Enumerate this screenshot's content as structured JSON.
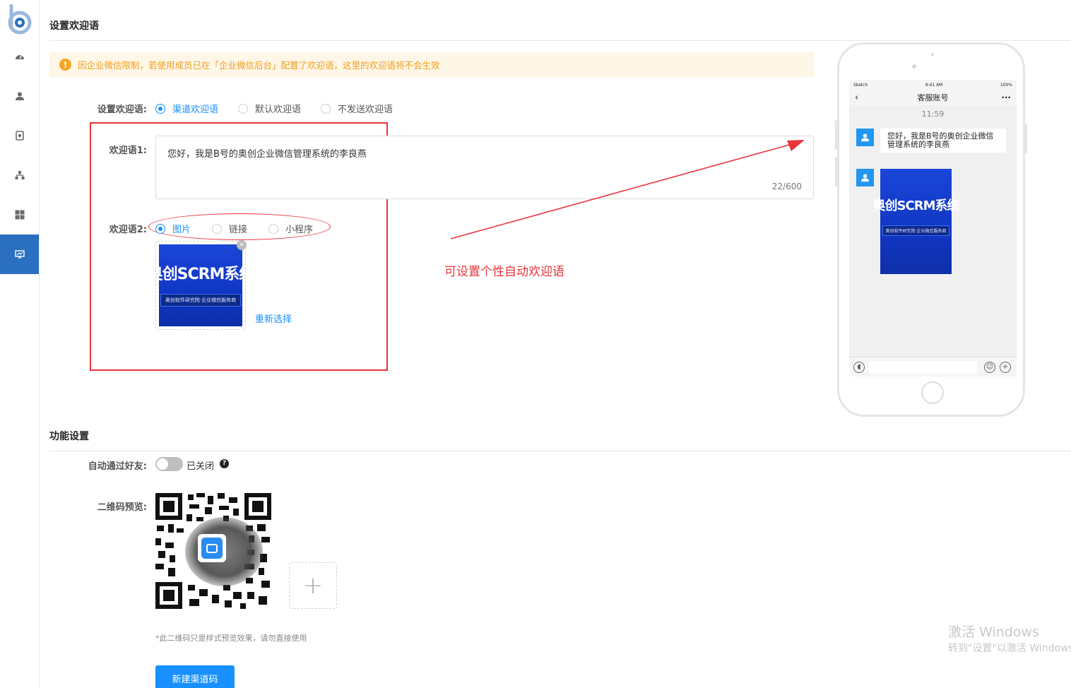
{
  "sidebar": {
    "items": [
      {
        "icon": "dashboard-icon"
      },
      {
        "icon": "user-icon"
      },
      {
        "icon": "shield-icon"
      },
      {
        "icon": "org-chart-icon"
      },
      {
        "icon": "grid-icon"
      },
      {
        "icon": "presentation-chart-icon",
        "active": true
      }
    ]
  },
  "welcome_section": {
    "title": "设置欢迎语",
    "warning": "因企业微信限制，若使用成员已在「企业微信后台」配置了欢迎语，这里的欢迎语将不会生效",
    "label": "设置欢迎语:",
    "options": [
      "渠道欢迎语",
      "默认欢迎语",
      "不发送欢迎语"
    ],
    "selected": "渠道欢迎语",
    "msg1_label": "欢迎语1:",
    "msg1_text": "您好，我是B号的奥创企业微信管理系统的李良燕",
    "msg1_count": "22/600",
    "msg2_label": "欢迎语2:",
    "msg2_options": [
      "图片",
      "链接",
      "小程序"
    ],
    "msg2_selected": "图片",
    "poster_title": "奥创SCRM系统",
    "poster_sub": "奥创软件研究院·企业微信服务商",
    "reselect": "重新选择",
    "annotation": "可设置个性自动欢迎语"
  },
  "phone": {
    "carrier": "Sketch",
    "time": "9:41 AM",
    "battery": "100%",
    "title": "客服账号",
    "chat_time": "11:59",
    "message": "您好，我是B号的奥创企业微信管理系统的李良燕"
  },
  "function_section": {
    "title": "功能设置",
    "auto_accept_label": "自动通过好友:",
    "auto_accept_state": "已关闭",
    "qr_label": "二维码预览:",
    "qr_note": "*此二维码只是样式预览效果，请勿直接使用",
    "create_button": "新建渠道码"
  },
  "watermark": {
    "line1": "激活 Windows",
    "line2": "转到\"设置\"以激活 Windows。"
  },
  "colors": {
    "primary": "#1890ff",
    "sidebar_active": "#2a6fc0",
    "warning_bg": "#fef6e6",
    "warning_text": "#f0a020",
    "annotation_red": "#e8343a"
  }
}
